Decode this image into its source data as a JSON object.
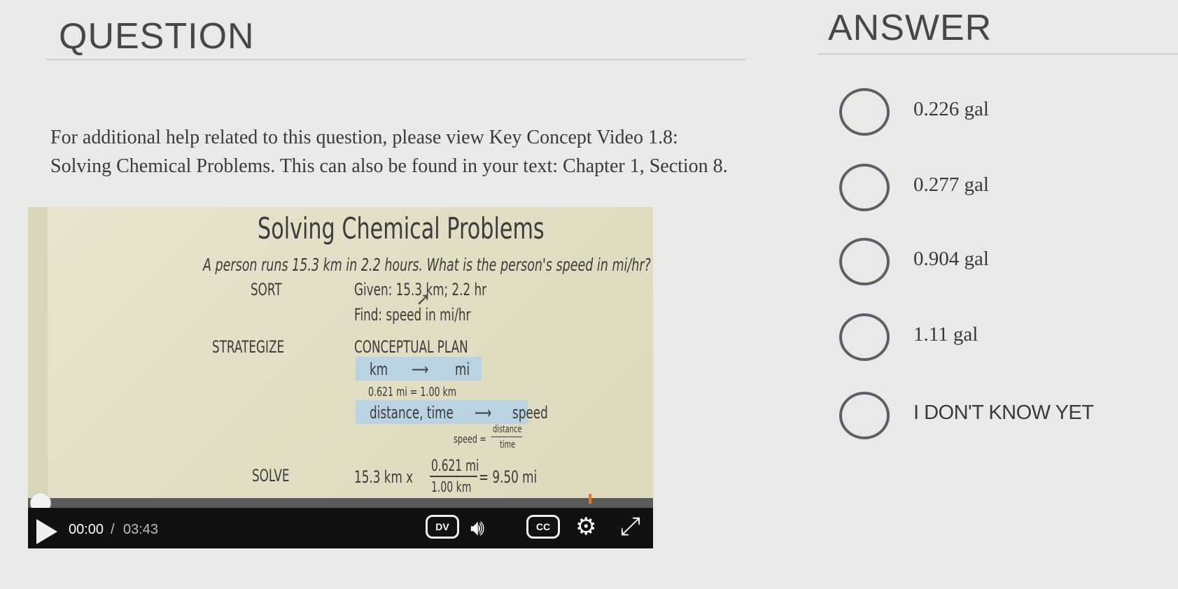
{
  "question": {
    "heading": "QUESTION",
    "help_text": "For additional help related to this question, please view Key Concept Video 1.8: Solving Chemical Problems. This can also be found in your text: Chapter 1, Section 8."
  },
  "video": {
    "slide": {
      "title": "Solving Chemical Problems",
      "question": "A person runs 15.3 km in 2.2 hours. What is the person's speed in mi/hr?",
      "sort_label": "SORT",
      "given": "Given: 15.3 km; 2.2 hr",
      "find": "Find: speed in mi/hr",
      "strategize_label": "STRATEGIZE",
      "plan_label": "CONCEPTUAL PLAN",
      "plan1_from": "km",
      "plan1_to": "mi",
      "arrow": "⟶",
      "conversion": "0.621 mi = 1.00 km",
      "plan2_from": "distance, time",
      "plan2_to": "speed",
      "formula_lhs": "speed =",
      "formula_num": "distance",
      "formula_den": "time",
      "solve_label": "SOLVE",
      "calc_lhs": "15.3 km x",
      "calc_num": "0.621 mi",
      "calc_den": "1.00 km",
      "calc_rhs": "= 9.50 mi"
    },
    "current_time": "00:00",
    "separator": "/",
    "duration": "03:43",
    "dv_label": "DV",
    "cc_label": "CC",
    "icons": [
      "play-icon",
      "volume-icon",
      "gear-icon",
      "fullscreen-icon",
      "cursor-icon"
    ]
  },
  "answer": {
    "heading": "ANSWER",
    "options": [
      {
        "label": "0.226 gal"
      },
      {
        "label": "0.277 gal"
      },
      {
        "label": "0.904 gal"
      },
      {
        "label": "1.11 gal"
      },
      {
        "label": "I DON'T KNOW YET"
      }
    ]
  },
  "colors": {
    "background": "#e9e9e8",
    "heading": "#474747",
    "radio_border": "#5a6068",
    "plan_box": "#b9d3e3",
    "progress_marker": "#e07b1a"
  }
}
